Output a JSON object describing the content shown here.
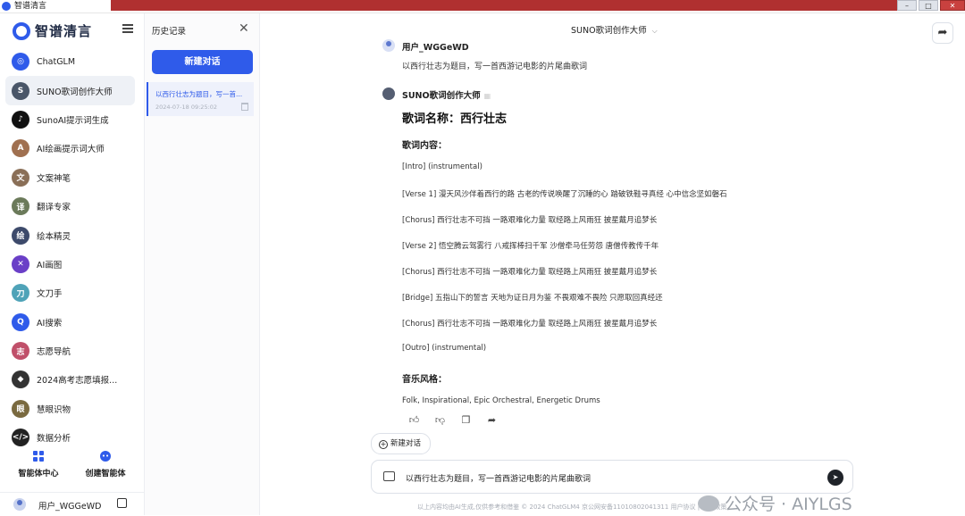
{
  "window": {
    "title": "智谱清言"
  },
  "sidebar": {
    "logo_text": "智谱清言",
    "agents": [
      {
        "label": "ChatGLM",
        "color": "#2f5bea",
        "glyph": "◎"
      },
      {
        "label": "SUNO歌词创作大师",
        "color": "#4a5668",
        "glyph": "S"
      },
      {
        "label": "SunoAI提示词生成",
        "color": "#111111",
        "glyph": "♪"
      },
      {
        "label": "AI绘画提示词大师",
        "color": "#a07050",
        "glyph": "A"
      },
      {
        "label": "文案神笔",
        "color": "#8a6f57",
        "glyph": "文"
      },
      {
        "label": "翻译专家",
        "color": "#6b7a5a",
        "glyph": "译"
      },
      {
        "label": "绘本精灵",
        "color": "#3d4a6b",
        "glyph": "绘"
      },
      {
        "label": "AI画图",
        "color": "#6a3fc7",
        "glyph": "✕"
      },
      {
        "label": "文刀手",
        "color": "#4fa3b8",
        "glyph": "刀"
      },
      {
        "label": "AI搜索",
        "color": "#2f5bea",
        "glyph": "Q"
      },
      {
        "label": "志愿导航",
        "color": "#c0506a",
        "glyph": "志"
      },
      {
        "label": "2024高考志愿填报...",
        "color": "#333333",
        "glyph": "◆"
      },
      {
        "label": "慧眼识物",
        "color": "#7a6a40",
        "glyph": "眼"
      },
      {
        "label": "数据分析",
        "color": "#222222",
        "glyph": "</>"
      }
    ],
    "tabs": {
      "agent_center": "智能体中心",
      "create_agent": "创建智能体"
    },
    "user_name": "用户_WGGeWD"
  },
  "history": {
    "title": "历史记录",
    "new_chat": "新建对话",
    "item_title": "以西行壮志为题目，写一首...",
    "item_date": "2024-07-18 09:25:02"
  },
  "chat": {
    "title": "SUNO歌词创作大师",
    "user_name": "用户_WGGeWD",
    "user_message": "以西行壮志为题目，写一首西游记电影的片尾曲歌词",
    "bot_name": "SUNO歌词创作大师",
    "song_title": "歌词名称：西行壮志",
    "lyrics_heading": "歌词内容：",
    "lyrics": [
      "[Intro] (instrumental)",
      "[Verse 1] 漫天风沙伴着西行的路 古老的传说唤醒了沉睡的心 踏破铁鞋寻真经 心中信念坚如磐石",
      "[Chorus] 西行壮志不可挡 一路艰难化力量 取经路上风雨狂 披星戴月追梦长",
      "[Verse 2] 悟空腾云驾雾行 八戒挥棒扫千军 沙僧牵马任劳怨 唐僧传教传千年",
      "[Chorus] 西行壮志不可挡 一路艰难化力量 取经路上风雨狂 披星戴月追梦长",
      "[Bridge] 五指山下的誓言 天地为证日月为鉴 不畏艰难不畏险 只愿取回真经还",
      "[Chorus] 西行壮志不可挡 一路艰难化力量 取经路上风雨狂 披星戴月追梦长",
      "[Outro] (instrumental)"
    ],
    "style_heading": "音乐风格：",
    "style": "Folk, Inspirational, Epic Orchestral, Energetic Drums",
    "new_chat_pill": "新建对话",
    "input_value": "以西行壮志为题目，写一首西游记电影的片尾曲歌词",
    "footer": "以上内容均由AI生成,仅供参考和借鉴    © 2024 ChatGLM4 京公网安备11010802041311    用户协议 | 隐私政策",
    "watermark": "公众号 · AIYLGS"
  }
}
